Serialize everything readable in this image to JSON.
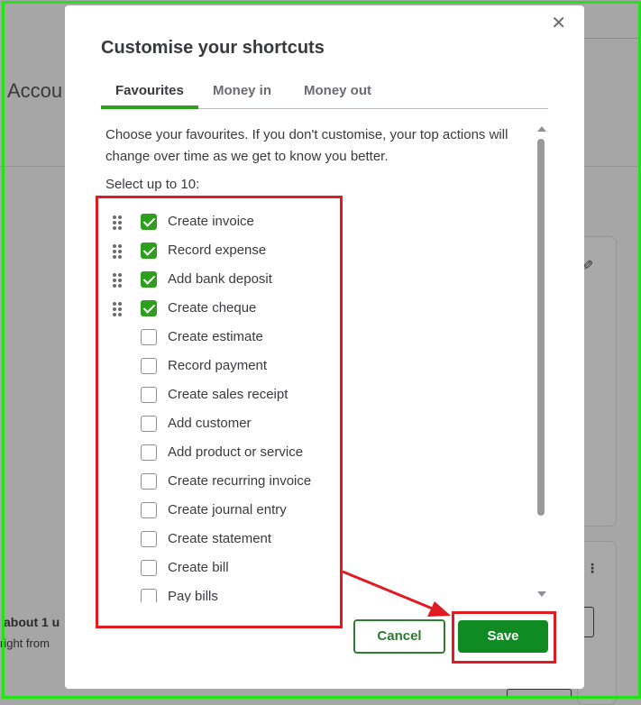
{
  "background": {
    "title_fragment": "Accou",
    "about_fragment": "about 1 u",
    "right_fragment": "right from"
  },
  "modal": {
    "title": "Customise your shortcuts",
    "close_icon": "close-icon",
    "tabs": [
      {
        "label": "Favourites",
        "active": true
      },
      {
        "label": "Money in",
        "active": false
      },
      {
        "label": "Money out",
        "active": false
      }
    ],
    "intro": "Choose your favourites. If you don't customise, your top actions will change over time as we get to know you better.",
    "select_label": "Select up to 10:",
    "items": [
      {
        "label": "Create invoice",
        "checked": true
      },
      {
        "label": "Record expense",
        "checked": true
      },
      {
        "label": "Add bank deposit",
        "checked": true
      },
      {
        "label": "Create cheque",
        "checked": true
      },
      {
        "label": "Create estimate",
        "checked": false
      },
      {
        "label": "Record payment",
        "checked": false
      },
      {
        "label": "Create sales receipt",
        "checked": false
      },
      {
        "label": "Add customer",
        "checked": false
      },
      {
        "label": "Add product or service",
        "checked": false
      },
      {
        "label": "Create recurring invoice",
        "checked": false
      },
      {
        "label": "Create journal entry",
        "checked": false
      },
      {
        "label": "Create statement",
        "checked": false
      },
      {
        "label": "Create bill",
        "checked": false
      },
      {
        "label": "Pay bills",
        "checked": false
      }
    ],
    "cancel_label": "Cancel",
    "save_label": "Save"
  },
  "colors": {
    "accent_green": "#2ca01c",
    "save_green": "#108a22",
    "annotation_red": "#e11b22",
    "annotation_green": "#22e31a"
  }
}
